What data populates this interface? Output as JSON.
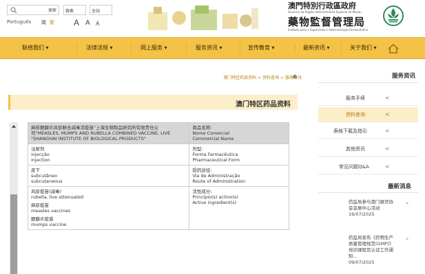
{
  "header": {
    "org_name_zh_1": "澳門特別行政區政府",
    "org_name_pt_1": "Governo da Região Administrativa Especial de Macau",
    "org_name_zh_2": "藥物監督管理局",
    "org_name_pt_2": "Instituto para a Supervisão e Administração Farmacêutica",
    "search_button_label": "搜索",
    "site_select": "全站",
    "scope_select": "檢索",
    "lang_pt": "Português",
    "lang_sc": "简",
    "lang_tc": "繁",
    "font_large": "A",
    "font_medium": "A",
    "font_small": "A"
  },
  "nav": {
    "items": [
      "关于我们",
      "最新资讯",
      "宣传教育",
      "服务资讯",
      "网上服务",
      "法律法规",
      "联络我们"
    ]
  },
  "breadcrumb": {
    "items": [
      "服务资讯",
      "资料查询",
      "澳门特区药品资料"
    ]
  },
  "page_title": "澳门特区药品资料",
  "table": {
    "rows": [
      {
        "label_zh": "商品名称:",
        "label_pt": "Nome Comercial",
        "label_en": "Commercial Name",
        "value": [
          "麻疹腮腺炎风疹联合减毒活疫苗\"上海生物制品研究所有限责任公司\"MEASLES, MUMPS AND RUBELLA COMBINED VACCINE, LIVE \"SHANGHAI INSTITUTE OF BIOLOGICAL PRODUCTS\""
        ]
      },
      {
        "label_zh": "剂型:",
        "label_pt": "Forma Farmacêutica",
        "label_en": "Pharmaceutical Form",
        "value": [
          "注射剂",
          "injecção",
          "injection"
        ]
      },
      {
        "label_zh": "投药途径:",
        "label_pt": "Via de Administração",
        "label_en": "Route of Administration",
        "value": [
          "皮下",
          "subcutâneo",
          "subcutaneous"
        ]
      },
      {
        "label_zh": "活性成分:",
        "label_pt": "Princípio(s) activo(s)",
        "label_en": "Active ingredient(s)",
        "value": [
          "风疹疫苗(减毒)",
          "rubella, live attenuated",
          "麻疹疫苗",
          "measles vaccines",
          "腮腺炎疫苗",
          "mumps vaccine"
        ]
      }
    ]
  },
  "sidebar": {
    "title": "服务资讯",
    "items": [
      "服务手续",
      "资料查询",
      "表格下载及指引",
      "其他资讯",
      "常见问题Q&A"
    ],
    "active_index": 1
  },
  "news": {
    "title": "最新消息",
    "items": [
      {
        "text": "药监局参与澳门展贸协会会展中心活动",
        "date": "16/07/2025"
      },
      {
        "text": "药监局发布《药物生产质量管理规范(GMP)》培训课程及认证工作通知...",
        "date": "09/07/2025"
      }
    ]
  },
  "colors": {
    "nav_bg": "#f3c246",
    "title_bg": "#fbeec9",
    "accent": "#b07a0a",
    "table_head_bg": "#d6d6d6"
  }
}
